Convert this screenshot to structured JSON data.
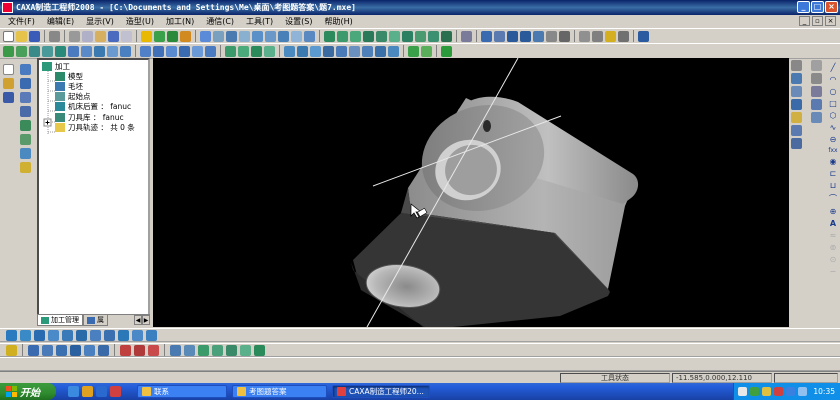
{
  "window": {
    "title": "CAXA制造工程师2008  - [C:\\Documents and Settings\\Me\\桌面\\考图题答案\\题7.mxe]",
    "controls": [
      "_",
      "□",
      "×"
    ]
  },
  "menu": {
    "items": [
      "文件(F)",
      "编辑(E)",
      "显示(V)",
      "造型(U)",
      "加工(N)",
      "通信(C)",
      "工具(T)",
      "设置(S)",
      "帮助(H)"
    ]
  },
  "tree": {
    "items": [
      {
        "label": "加工",
        "icon": "machining-folder-icon"
      },
      {
        "label": "模型",
        "icon": "model-icon"
      },
      {
        "label": "毛坯",
        "icon": "blank-stock-icon"
      },
      {
        "label": "起始点",
        "icon": "start-point-icon"
      },
      {
        "label": "机床后置 ： fanuc",
        "icon": "machine-post-icon"
      },
      {
        "label": "刀具库 ： fanuc",
        "icon": "tool-library-icon"
      },
      {
        "label": "刀具轨迹 ： 共 0 条",
        "icon": "toolpath-folder-icon"
      }
    ],
    "tabs": [
      "加工管理",
      "属"
    ]
  },
  "status": {
    "mode": "工具状态",
    "coordinates": "-11.585,0.000,12.110"
  },
  "taskbar": {
    "start_label": "开始",
    "tasks": [
      "联系",
      "考图题答案",
      "CAXA制造工程师20..."
    ],
    "clock": "10:35"
  },
  "colors": {
    "viewport_bg": "#000000",
    "part_light": "#a8a8a8",
    "part_dark": "#3c3c3c",
    "taskbar": "#245edb",
    "titlebar": "#0a246a"
  }
}
